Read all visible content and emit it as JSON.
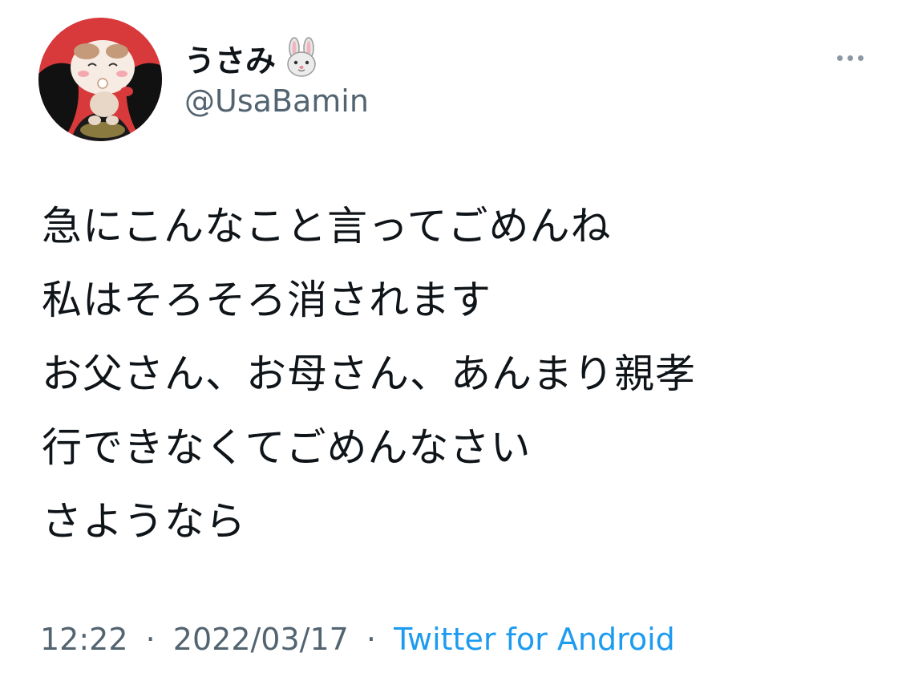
{
  "user": {
    "display_name": "うさみ",
    "emoji": "rabbit-face-icon",
    "handle": "@UsaBamin"
  },
  "tweet": {
    "lines": [
      "急にこんなこと言ってごめんね",
      "私はそろそろ消されます",
      "お父さん、お母さん、あんまり親孝",
      "行できなくてごめんなさい",
      "さようなら"
    ]
  },
  "meta": {
    "time": "12:22",
    "separator": "·",
    "date": "2022/03/17",
    "source": "Twitter for Android"
  },
  "colors": {
    "text": "#0f1419",
    "secondary": "#536471",
    "link": "#1d9bf0",
    "avatar_bg": "#d8393a"
  }
}
